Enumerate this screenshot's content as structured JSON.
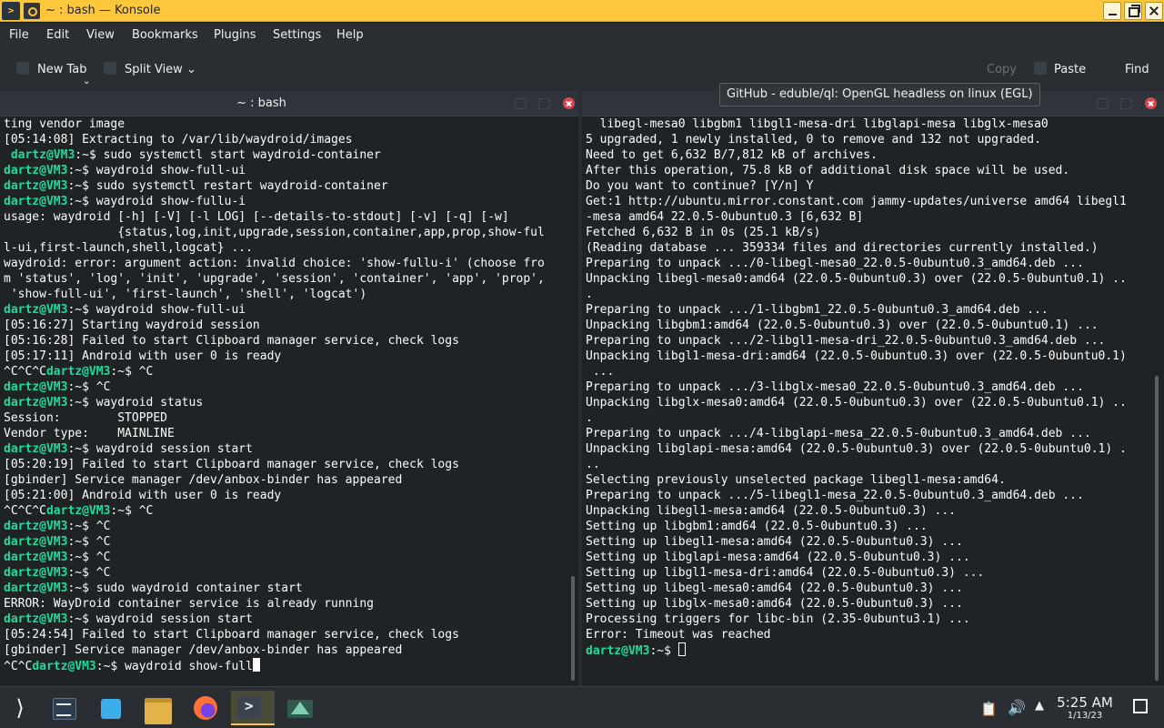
{
  "window": {
    "title": "~ : bash — Konsole"
  },
  "menu": [
    "File",
    "Edit",
    "View",
    "Bookmarks",
    "Plugins",
    "Settings",
    "Help"
  ],
  "toolbar": {
    "new_tab": "New Tab",
    "split_view": "Split View",
    "copy": "Copy",
    "paste": "Paste",
    "find": "Find"
  },
  "tabs": {
    "left_title": "~ : bash",
    "right_title": "~ : bash"
  },
  "tooltip": "GitHub - eduble/ql: OpenGL headless on linux (EGL)",
  "prompt": "dartz@VM3",
  "left_terminal": [
    {
      "t": "out",
      "text": "ting vendor image"
    },
    {
      "t": "out",
      "text": "[05:14:08] Extracting to /var/lib/waydroid/images"
    },
    {
      "t": "cmd",
      "pre": " ",
      "user": "dartz@VM3",
      "path": ":~",
      "text": "$ sudo systemctl start waydroid-container"
    },
    {
      "t": "cmd",
      "pre": "",
      "user": "dartz@VM3",
      "path": ":~",
      "text": "$ waydroid show-full-ui"
    },
    {
      "t": "cmd",
      "pre": "",
      "user": "dartz@VM3",
      "path": ":~",
      "text": "$ sudo systemctl restart waydroid-container"
    },
    {
      "t": "cmd",
      "pre": "",
      "user": "dartz@VM3",
      "path": ":~",
      "text": "$ waydroid show-fullu-i"
    },
    {
      "t": "out",
      "text": "usage: waydroid [-h] [-V] [-l LOG] [--details-to-stdout] [-v] [-q] [-w]"
    },
    {
      "t": "out",
      "text": "                {status,log,init,upgrade,session,container,app,prop,show-ful"
    },
    {
      "t": "out",
      "text": "l-ui,first-launch,shell,logcat} ..."
    },
    {
      "t": "out",
      "text": "waydroid: error: argument action: invalid choice: 'show-fullu-i' (choose fro"
    },
    {
      "t": "out",
      "text": "m 'status', 'log', 'init', 'upgrade', 'session', 'container', 'app', 'prop',"
    },
    {
      "t": "out",
      "text": " 'show-full-ui', 'first-launch', 'shell', 'logcat')"
    },
    {
      "t": "cmd",
      "pre": "",
      "user": "dartz@VM3",
      "path": ":~",
      "text": "$ waydroid show-full-ui"
    },
    {
      "t": "out",
      "text": "[05:16:27] Starting waydroid session"
    },
    {
      "t": "out",
      "text": "[05:16:28] Failed to start Clipboard manager service, check logs"
    },
    {
      "t": "out",
      "text": "[05:17:11] Android with user 0 is ready"
    },
    {
      "t": "cmd",
      "pre": "^C^C^C",
      "user": "dartz@VM3",
      "path": ":~",
      "text": "$ ^C"
    },
    {
      "t": "cmd",
      "pre": "",
      "user": "dartz@VM3",
      "path": ":~",
      "text": "$ ^C"
    },
    {
      "t": "cmd",
      "pre": "",
      "user": "dartz@VM3",
      "path": ":~",
      "text": "$ waydroid status"
    },
    {
      "t": "out",
      "text": "Session:        STOPPED"
    },
    {
      "t": "out",
      "text": "Vendor type:    MAINLINE"
    },
    {
      "t": "cmd",
      "pre": "",
      "user": "dartz@VM3",
      "path": ":~",
      "text": "$ waydroid session start"
    },
    {
      "t": "out",
      "text": "[05:20:19] Failed to start Clipboard manager service, check logs"
    },
    {
      "t": "out",
      "text": "[gbinder] Service manager /dev/anbox-binder has appeared"
    },
    {
      "t": "out",
      "text": "[05:21:00] Android with user 0 is ready"
    },
    {
      "t": "cmd",
      "pre": "^C^C^C",
      "user": "dartz@VM3",
      "path": ":~",
      "text": "$ ^C"
    },
    {
      "t": "cmd",
      "pre": "",
      "user": "dartz@VM3",
      "path": ":~",
      "text": "$ ^C"
    },
    {
      "t": "cmd",
      "pre": "",
      "user": "dartz@VM3",
      "path": ":~",
      "text": "$ ^C"
    },
    {
      "t": "cmd",
      "pre": "",
      "user": "dartz@VM3",
      "path": ":~",
      "text": "$ ^C"
    },
    {
      "t": "cmd",
      "pre": "",
      "user": "dartz@VM3",
      "path": ":~",
      "text": "$ ^C"
    },
    {
      "t": "cmd",
      "pre": "",
      "user": "dartz@VM3",
      "path": ":~",
      "text": "$ sudo waydroid container start"
    },
    {
      "t": "out",
      "text": "ERROR: WayDroid container service is already running"
    },
    {
      "t": "cmd",
      "pre": "",
      "user": "dartz@VM3",
      "path": ":~",
      "text": "$ waydroid session start"
    },
    {
      "t": "out",
      "text": "[05:24:54] Failed to start Clipboard manager service, check logs"
    },
    {
      "t": "out",
      "text": "[gbinder] Service manager /dev/anbox-binder has appeared"
    },
    {
      "t": "cmd",
      "pre": "^C^C",
      "user": "dartz@VM3",
      "path": ":~",
      "text": "$ waydroid show-full",
      "cursor": "solid"
    }
  ],
  "right_terminal": [
    {
      "t": "out",
      "text": "  libegl-mesa0 libgbm1 libgl1-mesa-dri libglapi-mesa libglx-mesa0"
    },
    {
      "t": "out",
      "text": "5 upgraded, 1 newly installed, 0 to remove and 132 not upgraded."
    },
    {
      "t": "out",
      "text": "Need to get 6,632 B/7,812 kB of archives."
    },
    {
      "t": "out",
      "text": "After this operation, 75.8 kB of additional disk space will be used."
    },
    {
      "t": "out",
      "text": "Do you want to continue? [Y/n] Y"
    },
    {
      "t": "out",
      "text": "Get:1 http://ubuntu.mirror.constant.com jammy-updates/universe amd64 libegl1"
    },
    {
      "t": "out",
      "text": "-mesa amd64 22.0.5-0ubuntu0.3 [6,632 B]"
    },
    {
      "t": "out",
      "text": "Fetched 6,632 B in 0s (25.1 kB/s)"
    },
    {
      "t": "out",
      "text": "(Reading database ... 359334 files and directories currently installed.)"
    },
    {
      "t": "out",
      "text": "Preparing to unpack .../0-libegl-mesa0_22.0.5-0ubuntu0.3_amd64.deb ..."
    },
    {
      "t": "out",
      "text": "Unpacking libegl-mesa0:amd64 (22.0.5-0ubuntu0.3) over (22.0.5-0ubuntu0.1) .."
    },
    {
      "t": "out",
      "text": "."
    },
    {
      "t": "out",
      "text": "Preparing to unpack .../1-libgbm1_22.0.5-0ubuntu0.3_amd64.deb ..."
    },
    {
      "t": "out",
      "text": "Unpacking libgbm1:amd64 (22.0.5-0ubuntu0.3) over (22.0.5-0ubuntu0.1) ..."
    },
    {
      "t": "out",
      "text": "Preparing to unpack .../2-libgl1-mesa-dri_22.0.5-0ubuntu0.3_amd64.deb ..."
    },
    {
      "t": "out",
      "text": "Unpacking libgl1-mesa-dri:amd64 (22.0.5-0ubuntu0.3) over (22.0.5-0ubuntu0.1)"
    },
    {
      "t": "out",
      "text": " ..."
    },
    {
      "t": "out",
      "text": "Preparing to unpack .../3-libglx-mesa0_22.0.5-0ubuntu0.3_amd64.deb ..."
    },
    {
      "t": "out",
      "text": "Unpacking libglx-mesa0:amd64 (22.0.5-0ubuntu0.3) over (22.0.5-0ubuntu0.1) .."
    },
    {
      "t": "out",
      "text": "."
    },
    {
      "t": "out",
      "text": "Preparing to unpack .../4-libglapi-mesa_22.0.5-0ubuntu0.3_amd64.deb ..."
    },
    {
      "t": "out",
      "text": "Unpacking libglapi-mesa:amd64 (22.0.5-0ubuntu0.3) over (22.0.5-0ubuntu0.1) ."
    },
    {
      "t": "out",
      "text": ".."
    },
    {
      "t": "out",
      "text": "Selecting previously unselected package libegl1-mesa:amd64."
    },
    {
      "t": "out",
      "text": "Preparing to unpack .../5-libegl1-mesa_22.0.5-0ubuntu0.3_amd64.deb ..."
    },
    {
      "t": "out",
      "text": "Unpacking libegl1-mesa:amd64 (22.0.5-0ubuntu0.3) ..."
    },
    {
      "t": "out",
      "text": "Setting up libgbm1:amd64 (22.0.5-0ubuntu0.3) ..."
    },
    {
      "t": "out",
      "text": "Setting up libegl1-mesa:amd64 (22.0.5-0ubuntu0.3) ..."
    },
    {
      "t": "out",
      "text": "Setting up libglapi-mesa:amd64 (22.0.5-0ubuntu0.3) ..."
    },
    {
      "t": "out",
      "text": "Setting up libgl1-mesa-dri:amd64 (22.0.5-0ubuntu0.3) ..."
    },
    {
      "t": "out",
      "text": "Setting up libegl-mesa0:amd64 (22.0.5-0ubuntu0.3) ..."
    },
    {
      "t": "out",
      "text": "Setting up libglx-mesa0:amd64 (22.0.5-0ubuntu0.3) ..."
    },
    {
      "t": "out",
      "text": "Processing triggers for libc-bin (2.35-0ubuntu3.1) ..."
    },
    {
      "t": "out",
      "text": "Error: Timeout was reached"
    },
    {
      "t": "cmd",
      "pre": "",
      "user": "dartz@VM3",
      "path": ":~",
      "text": "$ ",
      "cursor": "hollow"
    }
  ],
  "taskbar": {
    "apps": [
      "launcher-icon",
      "system-settings-icon",
      "discover-store-icon",
      "file-manager-icon",
      "firefox-icon",
      "konsole-icon",
      "app-icon"
    ]
  },
  "tray": {
    "time": "5:25 AM",
    "date": "1/13/23"
  },
  "colors": {
    "titlebar": "#fcc73d",
    "prompt": "#1cdc9a",
    "terminal_bg": "#1f2326",
    "close": "#da4453"
  }
}
